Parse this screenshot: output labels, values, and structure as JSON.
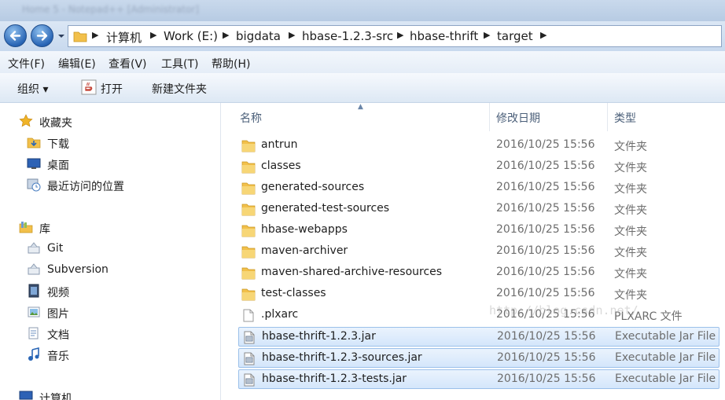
{
  "window": {
    "title": "Home 5 - Notepad++ [Administrator]"
  },
  "breadcrumbs": [
    "计算机",
    "Work (E:)",
    "bigdata",
    "hbase-1.2.3-src",
    "hbase-thrift",
    "target"
  ],
  "menu": [
    "文件(F)",
    "编辑(E)",
    "查看(V)",
    "工具(T)",
    "帮助(H)"
  ],
  "toolbar": {
    "organize": "组织 ▾",
    "open": "打开",
    "new_folder": "新建文件夹"
  },
  "nav": {
    "favorites": {
      "label": "收藏夹",
      "items": [
        "下载",
        "桌面",
        "最近访问的位置"
      ]
    },
    "libraries": {
      "label": "库",
      "items": [
        "Git",
        "Subversion",
        "视频",
        "图片",
        "文档",
        "音乐"
      ]
    },
    "computer": {
      "label": "计算机"
    }
  },
  "columns": {
    "name": "名称",
    "date": "修改日期",
    "type": "类型"
  },
  "files": [
    {
      "name": "antrun",
      "date": "2016/10/25 15:56",
      "type": "文件夹",
      "kind": "folder",
      "selected": false
    },
    {
      "name": "classes",
      "date": "2016/10/25 15:56",
      "type": "文件夹",
      "kind": "folder",
      "selected": false
    },
    {
      "name": "generated-sources",
      "date": "2016/10/25 15:56",
      "type": "文件夹",
      "kind": "folder",
      "selected": false
    },
    {
      "name": "generated-test-sources",
      "date": "2016/10/25 15:56",
      "type": "文件夹",
      "kind": "folder",
      "selected": false
    },
    {
      "name": "hbase-webapps",
      "date": "2016/10/25 15:56",
      "type": "文件夹",
      "kind": "folder",
      "selected": false
    },
    {
      "name": "maven-archiver",
      "date": "2016/10/25 15:56",
      "type": "文件夹",
      "kind": "folder",
      "selected": false
    },
    {
      "name": "maven-shared-archive-resources",
      "date": "2016/10/25 15:56",
      "type": "文件夹",
      "kind": "folder",
      "selected": false
    },
    {
      "name": "test-classes",
      "date": "2016/10/25 15:56",
      "type": "文件夹",
      "kind": "folder",
      "selected": false
    },
    {
      "name": ".plxarc",
      "date": "2016/10/25 15:56",
      "type": "PLXARC 文件",
      "kind": "file",
      "selected": false
    },
    {
      "name": "hbase-thrift-1.2.3.jar",
      "date": "2016/10/25 15:56",
      "type": "Executable Jar File",
      "kind": "jar",
      "selected": true
    },
    {
      "name": "hbase-thrift-1.2.3-sources.jar",
      "date": "2016/10/25 15:56",
      "type": "Executable Jar File",
      "kind": "jar",
      "selected": true
    },
    {
      "name": "hbase-thrift-1.2.3-tests.jar",
      "date": "2016/10/25 15:56",
      "type": "Executable Jar File",
      "kind": "jar",
      "selected": true
    }
  ],
  "watermark": "http://blog.csdn.net/",
  "colors": {
    "folder": "#f2c04b",
    "selection": "#d4e6fb",
    "selection_border": "#9bc0ea",
    "nav_button": "#2a66b6"
  }
}
